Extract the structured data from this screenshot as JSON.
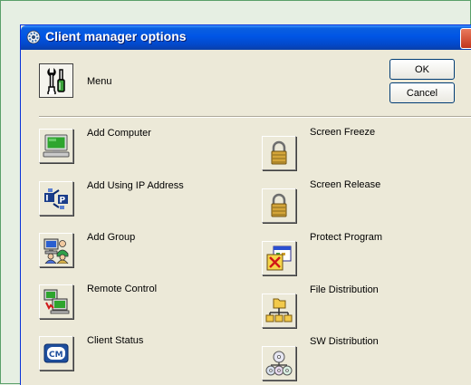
{
  "window": {
    "title": "Client manager options",
    "colors": {
      "titlebar": "#0055e5",
      "face": "#ece9d8",
      "close": "#c2351b",
      "page_bg": "#e6efe3"
    }
  },
  "menu": {
    "label": "Menu",
    "icon": "tools-icon"
  },
  "buttons": {
    "ok": "OK",
    "cancel": "Cancel"
  },
  "options_left": [
    {
      "label": "Add Computer",
      "icon": "computer-icon"
    },
    {
      "label": "Add Using IP Address",
      "icon": "ip-address-icon"
    },
    {
      "label": "Add Group",
      "icon": "group-icon"
    },
    {
      "label": "Remote Control",
      "icon": "remote-control-icon"
    },
    {
      "label": "Client Status",
      "icon": "cm-icon"
    }
  ],
  "options_right": [
    {
      "label": "Screen Freeze",
      "icon": "padlock-icon"
    },
    {
      "label": "Screen Release",
      "icon": "padlock-icon"
    },
    {
      "label": "Protect Program",
      "icon": "protect-program-icon"
    },
    {
      "label": "File Distribution",
      "icon": "file-distribution-icon"
    },
    {
      "label": "SW Distribution",
      "icon": "disc-distribution-icon"
    }
  ]
}
